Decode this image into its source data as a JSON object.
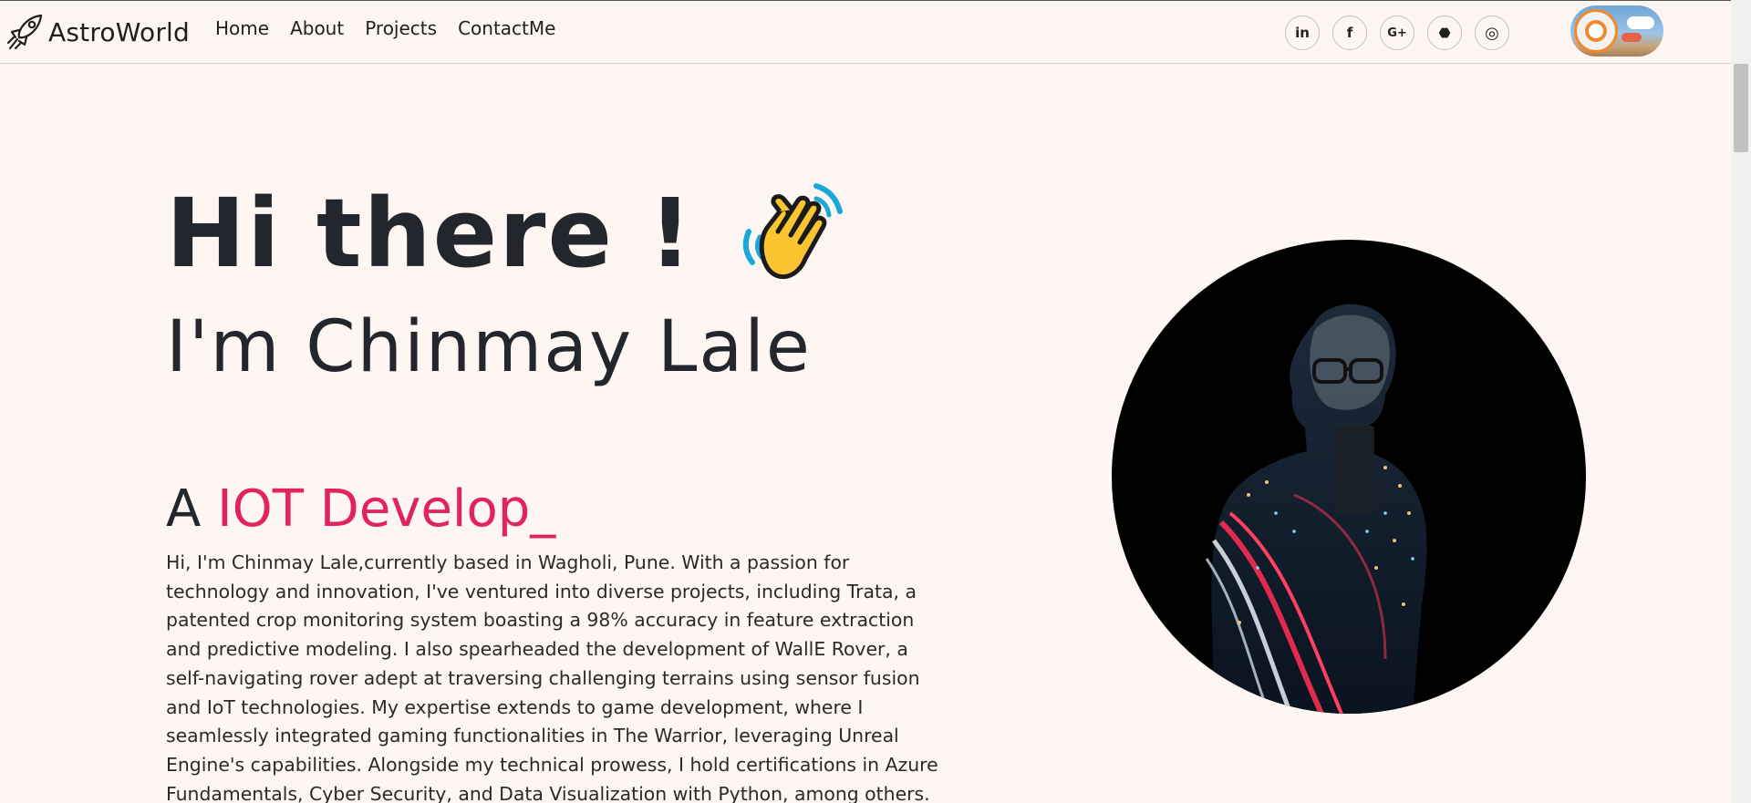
{
  "navbar": {
    "brand": "AstroWorld",
    "links": [
      "Home",
      "About",
      "Projects",
      "ContactMe"
    ],
    "socials": [
      {
        "icon": "linkedin-icon",
        "glyph": "in"
      },
      {
        "icon": "facebook-icon",
        "glyph": "f"
      },
      {
        "icon": "google-plus-icon",
        "glyph": "G+"
      },
      {
        "icon": "github-icon",
        "glyph": "⬣"
      },
      {
        "icon": "instagram-icon",
        "glyph": "◎"
      }
    ],
    "theme_toggle": {
      "state": "light"
    }
  },
  "hero": {
    "greeting": "Hi there !",
    "greeting_icon": "waving-hand-icon",
    "name": "I'm Chinmay Lale",
    "role_prefix": "A",
    "role_text": "IOT Develop",
    "role_cursor": "_",
    "bio": "Hi, I'm Chinmay Lale,currently based in Wagholi, Pune. With a passion for technology and innovation, I've ventured into diverse projects, including Trata, a patented crop monitoring system boasting a 98% accuracy in feature extraction and predictive modeling. I also spearheaded the development of WallE Rover, a self-navigating rover adept at traversing challenging terrains using sensor fusion and IoT technologies. My expertise extends to game development, where I seamlessly integrated gaming functionalities in The Warrior, leveraging Unreal Engine's capabilities. Alongside my technical prowess, I hold certifications in Azure Fundamentals, Cyber Security, and Data Visualization with Python, among others. With a Bachelor's in Technology from N."
  },
  "colors": {
    "background": "#fdf6f2",
    "text": "#23262d",
    "accent": "#e2245e"
  }
}
